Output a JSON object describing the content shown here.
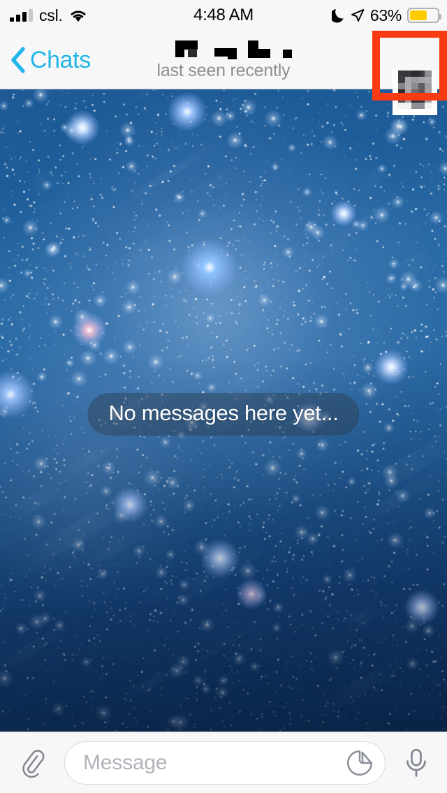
{
  "status_bar": {
    "carrier": "csl.",
    "time": "4:48 AM",
    "battery_percent": "63%",
    "battery_level": 63,
    "signal_bars_filled": 3,
    "signal_bars_total": 4,
    "icons": [
      "signal-bars-icon",
      "wifi-icon",
      "moon-icon",
      "location-arrow-icon",
      "battery-icon"
    ]
  },
  "nav_bar": {
    "back_label": "Chats",
    "back_icon": "chevron-left-icon",
    "title": "",
    "title_redacted": true,
    "subtitle": "last seen recently",
    "avatar_name": "contact-avatar",
    "highlight_color": "#f93b11"
  },
  "chat": {
    "empty_state_text": "No messages here yet...",
    "wallpaper": "starry-night-sky"
  },
  "input_bar": {
    "attach_icon": "paperclip-icon",
    "message_placeholder": "Message",
    "message_value": "",
    "sticker_icon": "sticker-icon",
    "mic_icon": "microphone-icon"
  },
  "colors": {
    "accent": "#23b6e8",
    "bar_background": "#f7f7f7",
    "subtitle": "#8e8e93",
    "battery_fill": "#ffcc00",
    "highlight": "#f93b11"
  }
}
